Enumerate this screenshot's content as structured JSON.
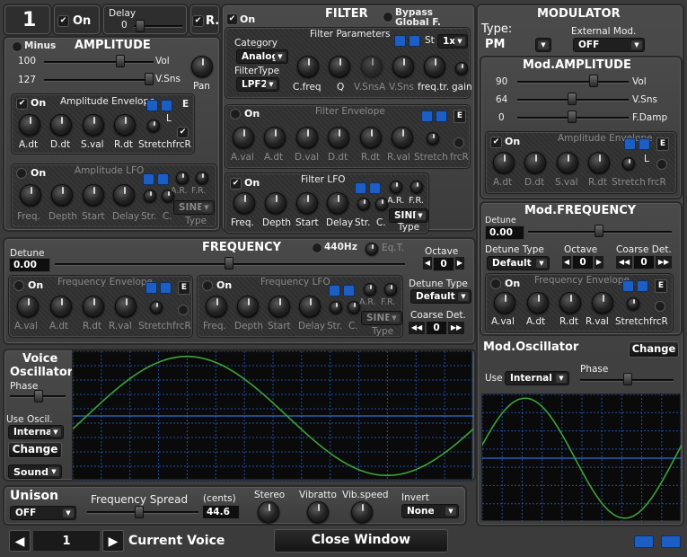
{
  "top": {
    "voice_number": "1",
    "on_label": "On",
    "delay_label": "Delay",
    "delay_value": "0",
    "r_label": "R."
  },
  "amplitude": {
    "minus_label": "Minus",
    "title": "AMPLITUDE",
    "vol_value": "100",
    "vol_label": "Vol",
    "vsns_value": "127",
    "vsns_label": "V.Sns",
    "pan_label": "Pan",
    "env": {
      "on_label": "On",
      "title": "Amplitude Envelope",
      "e_label": "E",
      "l_label": "L",
      "knobs": [
        "A.dt",
        "D.dt",
        "S.val",
        "R.dt",
        "Stretch",
        "frcR"
      ]
    },
    "lfo": {
      "on_label": "On",
      "title": "Amplitude LFO",
      "ar_label": "A.R.",
      "fr_label": "F.R.",
      "knobs": [
        "Freq.",
        "Depth",
        "Start",
        "Delay",
        "Str.",
        "C."
      ],
      "type_value": "SINE",
      "type_label": "Type"
    }
  },
  "filter": {
    "on_label": "On",
    "title": "FILTER",
    "bypass_label": "Bypass Global F.",
    "params_label": "Filter Parameters",
    "st_label": "St",
    "st_value": "1x",
    "category_label": "Category",
    "category_value": "Analog",
    "filtertype_label": "FilterType",
    "filtertype_value": "LPF2",
    "knobs": [
      "C.freq",
      "Q",
      "V.SnsA",
      "V.Sns",
      "freq.tr.",
      "gain"
    ],
    "env": {
      "on_label": "On",
      "title": "Filter Envelope",
      "e_label": "E",
      "knobs": [
        "A.val",
        "A.dt",
        "D.val",
        "D.dt",
        "R.dt",
        "R.val",
        "Stretch",
        "frcR"
      ]
    },
    "lfo": {
      "on_label": "On",
      "title": "Filter LFO",
      "ar_label": "A.R.",
      "fr_label": "F.R.",
      "knobs": [
        "Freq.",
        "Depth",
        "Start",
        "Delay",
        "Str.",
        "C."
      ],
      "type_value": "SINE",
      "type_label": "Type"
    }
  },
  "frequency": {
    "title": "FREQUENCY",
    "hz_label": "440Hz",
    "eqt_label": "Eq.T.",
    "detune_label": "Detune",
    "detune_value": "0.00",
    "octave_label": "Octave",
    "octave_value": "0",
    "detune_type_label": "Detune Type",
    "detune_type_value": "Default",
    "coarse_label": "Coarse Det.",
    "coarse_value": "0",
    "env": {
      "on_label": "On",
      "title": "Frequency Envelope",
      "e_label": "E",
      "knobs": [
        "A.val",
        "A.dt",
        "R.dt",
        "R.val",
        "Stretch",
        "frcR"
      ]
    },
    "lfo": {
      "on_label": "On",
      "title": "Frequency LFO",
      "ar_label": "A.R.",
      "fr_label": "F.R.",
      "knobs": [
        "Freq.",
        "Depth",
        "Start",
        "Delay",
        "Str.",
        "C."
      ],
      "type_value": "SINE",
      "type_label": "Type"
    }
  },
  "voice_osc": {
    "title_line1": "Voice",
    "title_line2": "Oscillator",
    "phase_label": "Phase",
    "use_label": "Use Oscil.",
    "use_value": "Internal",
    "change_label": "Change",
    "sound_value": "Sound"
  },
  "modulator": {
    "title": "MODULATOR",
    "type_label": "Type:",
    "type_value": "PM",
    "ext_label": "External Mod.",
    "ext_value": "OFF",
    "amp": {
      "title": "Mod.AMPLITUDE",
      "vol_value": "90",
      "vol_label": "Vol",
      "vsns_value": "64",
      "vsns_label": "V.Sns",
      "fdamp_value": "0",
      "fdamp_label": "F.Damp",
      "env": {
        "on_label": "On",
        "title": "Amplitude Envelope",
        "e_label": "E",
        "l_label": "L",
        "knobs": [
          "A.dt",
          "D.dt",
          "S.val",
          "R.dt",
          "Stretch",
          "frcR"
        ]
      }
    },
    "freq": {
      "title": "Mod.FREQUENCY",
      "detune_label": "Detune",
      "detune_value": "0.00",
      "detune_type_label": "Detune Type",
      "detune_type_value": "Default",
      "octave_label": "Octave",
      "octave_value": "0",
      "coarse_label": "Coarse Det.",
      "coarse_value": "0",
      "env": {
        "on_label": "On",
        "title": "Frequency Envelope",
        "e_label": "E",
        "knobs": [
          "A.val",
          "A.dt",
          "R.dt",
          "R.val",
          "Stretch",
          "frcR"
        ]
      }
    },
    "osc": {
      "title": "Mod.Oscillator",
      "change_label": "Change",
      "use_label": "Use",
      "use_value": "Internal",
      "phase_label": "Phase"
    }
  },
  "unison": {
    "title": "Unison",
    "value": "OFF",
    "spread_label": "Frequency Spread",
    "cents_label": "(cents)",
    "spread_value": "44.6",
    "stereo_label": "Stereo",
    "vibratto_label": "Vibratto",
    "vibspeed_label": "Vib.speed",
    "invert_label": "Invert",
    "invert_value": "None"
  },
  "bottom": {
    "voice_value": "1",
    "current_voice_label": "Current Voice",
    "close_label": "Close Window"
  },
  "colors": {
    "wave": "#3fa23a",
    "grid": "#1f4fa8",
    "accent_blue": "#1c5ec4"
  }
}
